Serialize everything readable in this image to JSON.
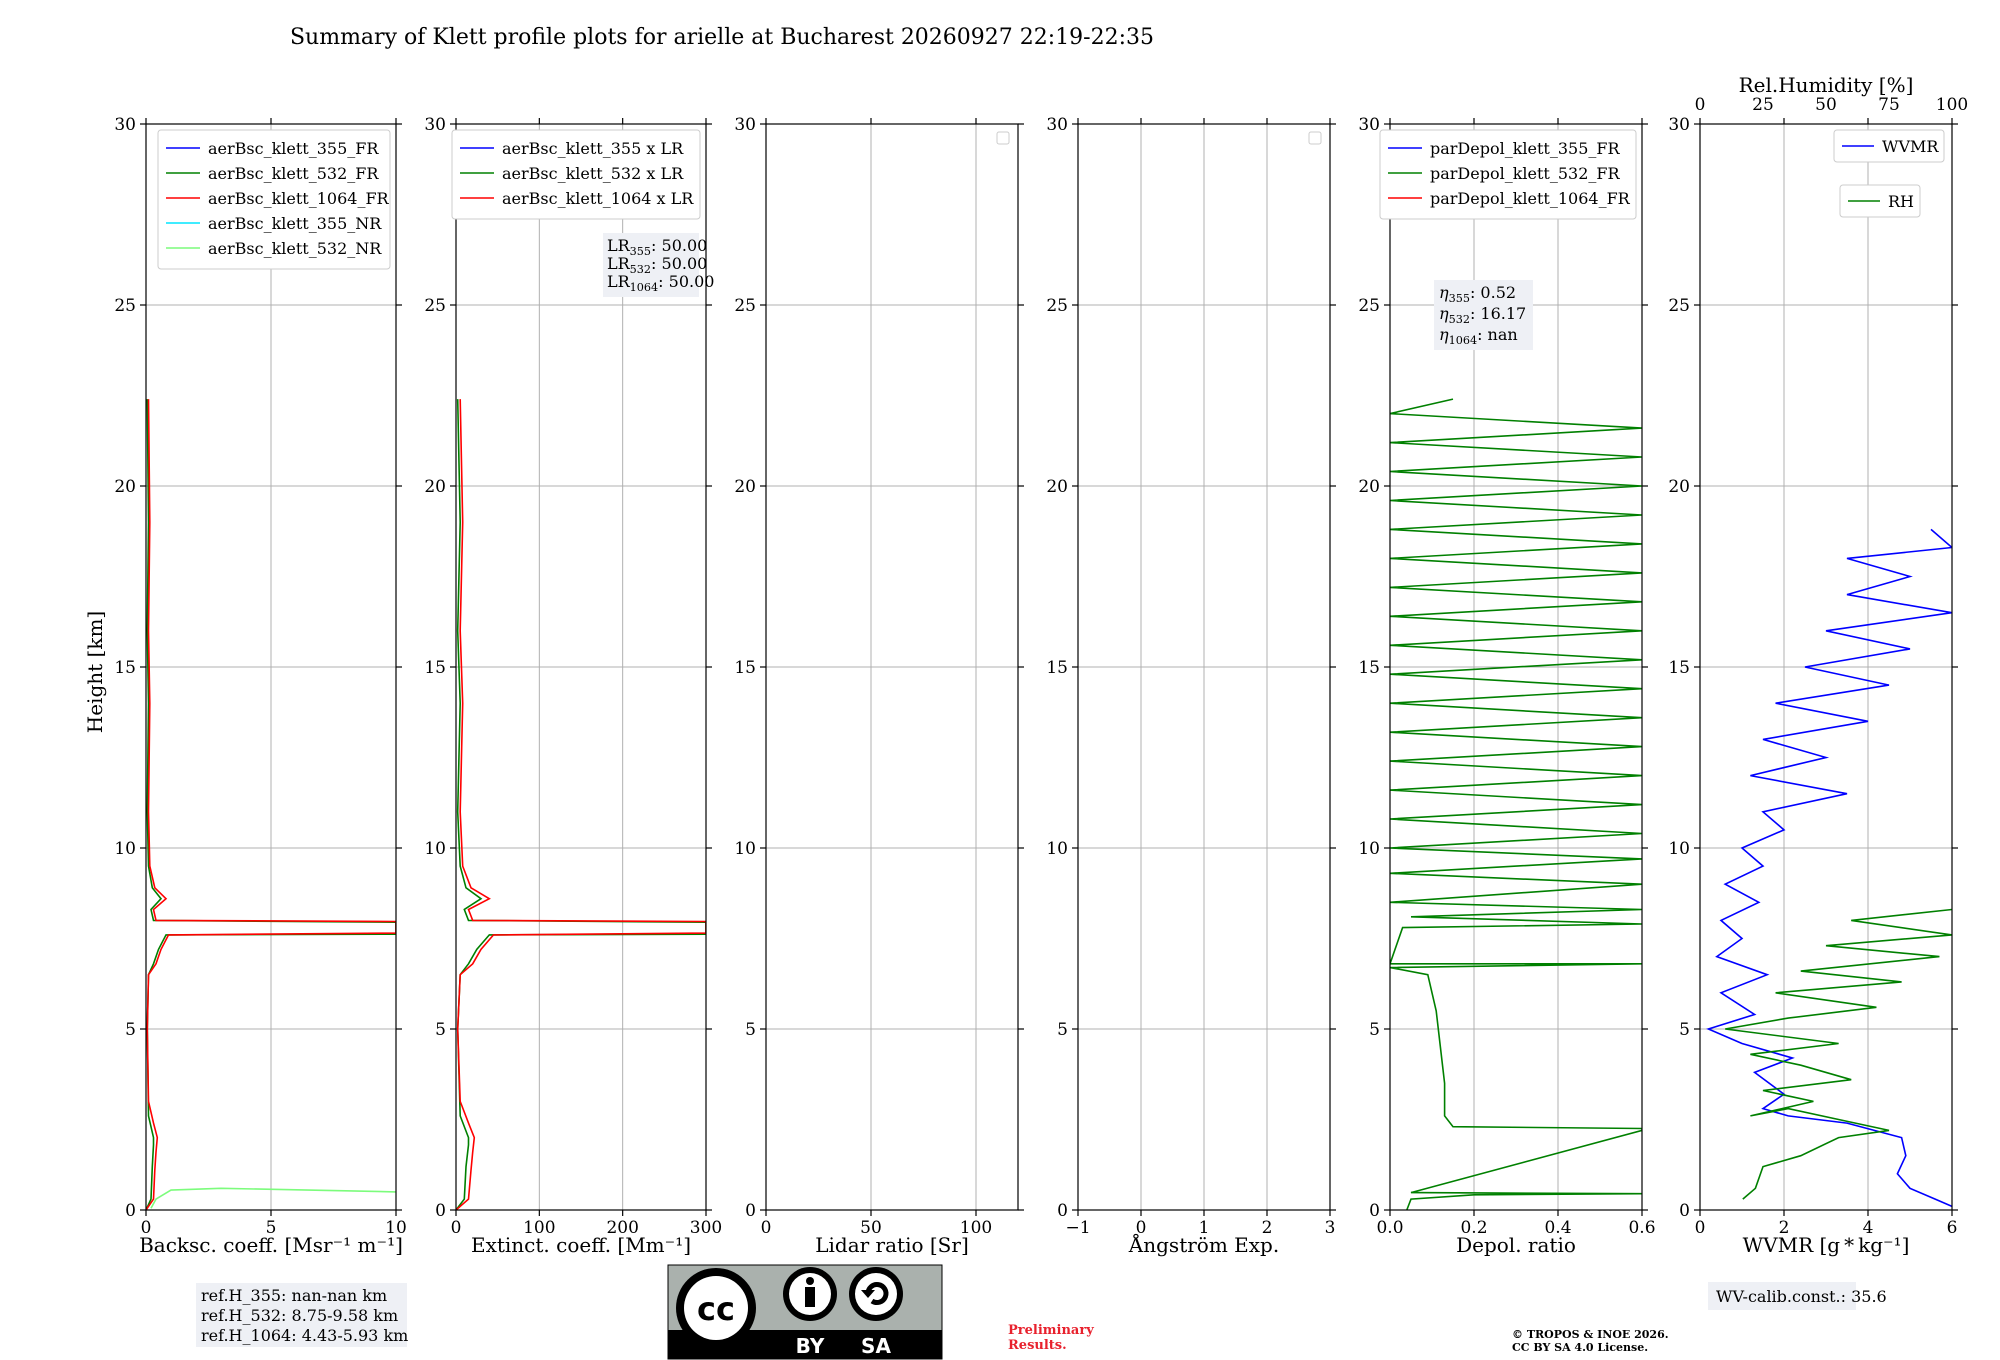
{
  "title": "Summary of Klett profile plots for arielle at Bucharest 20260927 22:19-22:35",
  "y_label": "Height [km]",
  "y_ticks": [
    "0",
    "5",
    "10",
    "15",
    "20",
    "25",
    "30"
  ],
  "chart_data": [
    {
      "type": "line",
      "xlabel": "Backsc. coeff. [Msr⁻¹ m⁻¹]",
      "xlim": [
        0,
        10
      ],
      "ylim": [
        0,
        30
      ],
      "x_ticks": [
        "0",
        "5",
        "10"
      ],
      "grid": true,
      "legend": "top-right",
      "series": [
        {
          "name": "aerBsc_klett_355_FR",
          "color": "#0000ff",
          "points": []
        },
        {
          "name": "aerBsc_klett_532_FR",
          "color": "#008000",
          "points": [
            [
              0,
              0
            ],
            [
              0.2,
              0.3
            ],
            [
              0.25,
              1.2
            ],
            [
              0.3,
              1.8
            ],
            [
              0.3,
              2.0
            ],
            [
              0.1,
              2.6
            ],
            [
              0.05,
              5
            ],
            [
              0.1,
              6.5
            ],
            [
              0.3,
              6.8
            ],
            [
              0.5,
              7.2
            ],
            [
              0.8,
              7.6
            ],
            [
              10,
              7.62
            ],
            [
              10,
              7.95
            ],
            [
              0.3,
              8.0
            ],
            [
              0.2,
              8.3
            ],
            [
              0.6,
              8.6
            ],
            [
              0.25,
              8.9
            ],
            [
              0.1,
              9.5
            ],
            [
              0.05,
              11
            ],
            [
              0.1,
              14
            ],
            [
              0.05,
              16
            ],
            [
              0.1,
              19
            ],
            [
              0.05,
              22.4
            ]
          ]
        },
        {
          "name": "aerBsc_klett_1064_FR",
          "color": "#ff0000",
          "points": [
            [
              0,
              0
            ],
            [
              0.3,
              0.3
            ],
            [
              0.35,
              1.1
            ],
            [
              0.4,
              1.6
            ],
            [
              0.45,
              2.0
            ],
            [
              0.3,
              2.4
            ],
            [
              0.1,
              3
            ],
            [
              0.05,
              5
            ],
            [
              0.1,
              6.5
            ],
            [
              0.4,
              6.8
            ],
            [
              0.6,
              7.2
            ],
            [
              0.9,
              7.6
            ],
            [
              10,
              7.65
            ],
            [
              10,
              7.97
            ],
            [
              0.4,
              8.0
            ],
            [
              0.3,
              8.3
            ],
            [
              0.8,
              8.6
            ],
            [
              0.35,
              8.9
            ],
            [
              0.15,
              9.5
            ],
            [
              0.1,
              11
            ],
            [
              0.15,
              14
            ],
            [
              0.1,
              16
            ],
            [
              0.15,
              19
            ],
            [
              0.1,
              22.4
            ]
          ]
        },
        {
          "name": "aerBsc_klett_355_NR",
          "color": "#00e5ff",
          "points": []
        },
        {
          "name": "aerBsc_klett_532_NR",
          "color": "#7cfc7c",
          "points": [
            [
              0.2,
              0.05
            ],
            [
              0.4,
              0.3
            ],
            [
              1,
              0.55
            ],
            [
              3,
              0.6
            ],
            [
              10,
              0.5
            ]
          ]
        }
      ],
      "info": []
    },
    {
      "type": "line",
      "xlabel": "Extinct. coeff. [Mm⁻¹]",
      "xlim": [
        0,
        300
      ],
      "ylim": [
        0,
        30
      ],
      "x_ticks": [
        "0",
        "100",
        "200",
        "300"
      ],
      "grid": true,
      "legend": "top-right",
      "series": [
        {
          "name": "aerBsc_klett_355 x LR",
          "color": "#0000ff",
          "points": []
        },
        {
          "name": "aerBsc_klett_532 x LR",
          "color": "#008000",
          "points": [
            [
              0,
              0
            ],
            [
              10,
              0.3
            ],
            [
              12,
              1.2
            ],
            [
              15,
              1.8
            ],
            [
              15,
              2.0
            ],
            [
              5,
              2.6
            ],
            [
              2,
              5
            ],
            [
              5,
              6.5
            ],
            [
              15,
              6.8
            ],
            [
              25,
              7.2
            ],
            [
              40,
              7.6
            ],
            [
              300,
              7.62
            ],
            [
              300,
              7.95
            ],
            [
              15,
              8.0
            ],
            [
              10,
              8.3
            ],
            [
              30,
              8.6
            ],
            [
              12,
              8.9
            ],
            [
              5,
              9.5
            ],
            [
              2,
              11
            ],
            [
              5,
              14
            ],
            [
              2,
              16
            ],
            [
              5,
              19
            ],
            [
              2,
              22.4
            ]
          ]
        },
        {
          "name": "aerBsc_klett_1064 x LR",
          "color": "#ff0000",
          "points": [
            [
              0,
              0
            ],
            [
              15,
              0.3
            ],
            [
              18,
              1.1
            ],
            [
              20,
              1.6
            ],
            [
              22,
              2.0
            ],
            [
              15,
              2.4
            ],
            [
              5,
              3
            ],
            [
              2,
              5
            ],
            [
              5,
              6.5
            ],
            [
              20,
              6.8
            ],
            [
              30,
              7.2
            ],
            [
              45,
              7.6
            ],
            [
              300,
              7.65
            ],
            [
              300,
              7.97
            ],
            [
              20,
              8.0
            ],
            [
              15,
              8.3
            ],
            [
              40,
              8.6
            ],
            [
              18,
              8.9
            ],
            [
              8,
              9.5
            ],
            [
              5,
              11
            ],
            [
              8,
              14
            ],
            [
              5,
              16
            ],
            [
              8,
              19
            ],
            [
              5,
              22.4
            ]
          ]
        }
      ],
      "info": [
        "LR355: 50.00",
        "LR532: 50.00",
        "LR1064: 50.00"
      ]
    },
    {
      "type": "line",
      "xlabel": "Lidar ratio [Sr]",
      "xlim": [
        0,
        120
      ],
      "ylim": [
        0,
        30
      ],
      "x_ticks": [
        "0",
        "50",
        "100"
      ],
      "grid": true,
      "legend": "top-right",
      "series": [],
      "info": []
    },
    {
      "type": "line",
      "xlabel": "Ångström Exp.",
      "xlim": [
        -1,
        3
      ],
      "ylim": [
        0,
        30
      ],
      "x_ticks": [
        "−1",
        "0",
        "1",
        "2",
        "3"
      ],
      "grid": true,
      "legend": "top-right",
      "series": [],
      "info": []
    },
    {
      "type": "line",
      "xlabel": "Depol. ratio",
      "xlim": [
        0,
        0.6
      ],
      "ylim": [
        0,
        30
      ],
      "x_ticks": [
        "0.0",
        "0.2",
        "0.4",
        "0.6"
      ],
      "grid": true,
      "legend": "top-right",
      "series": [
        {
          "name": "parDepol_klett_355_FR",
          "color": "#0000ff",
          "points": []
        },
        {
          "name": "parDepol_klett_532_FR",
          "color": "#008000",
          "points": [
            [
              0.04,
              0
            ],
            [
              0.05,
              0.3
            ],
            [
              0.2,
              0.42
            ],
            [
              0.6,
              0.45
            ],
            [
              0.05,
              0.48
            ],
            [
              0.6,
              2.2
            ],
            [
              0.6,
              2.25
            ],
            [
              0.15,
              2.3
            ],
            [
              0.13,
              2.6
            ],
            [
              0.13,
              3.5
            ],
            [
              0.12,
              4.5
            ],
            [
              0.11,
              5.5
            ],
            [
              0.09,
              6.5
            ],
            [
              0.0,
              6.7
            ],
            [
              0.6,
              6.8
            ],
            [
              0.0,
              6.8
            ],
            [
              0.03,
              7.8
            ],
            [
              0.6,
              7.9
            ],
            [
              0.05,
              8.1
            ],
            [
              0.6,
              8.3
            ],
            [
              0.0,
              8.5
            ],
            [
              0.6,
              9.0
            ],
            [
              0.0,
              9.3
            ],
            [
              0.6,
              9.7
            ],
            [
              0.0,
              10.0
            ],
            [
              0.6,
              10.4
            ],
            [
              0.0,
              10.8
            ],
            [
              0.6,
              11.2
            ],
            [
              0.0,
              11.6
            ],
            [
              0.6,
              12.0
            ],
            [
              0.0,
              12.4
            ],
            [
              0.6,
              12.8
            ],
            [
              0.0,
              13.2
            ],
            [
              0.6,
              13.6
            ],
            [
              0.0,
              14.0
            ],
            [
              0.6,
              14.4
            ],
            [
              0.0,
              14.8
            ],
            [
              0.6,
              15.2
            ],
            [
              0.0,
              15.6
            ],
            [
              0.6,
              16.0
            ],
            [
              0.0,
              16.4
            ],
            [
              0.6,
              16.8
            ],
            [
              0.0,
              17.2
            ],
            [
              0.6,
              17.6
            ],
            [
              0.0,
              18.0
            ],
            [
              0.6,
              18.4
            ],
            [
              0.0,
              18.8
            ],
            [
              0.6,
              19.2
            ],
            [
              0.0,
              19.6
            ],
            [
              0.6,
              20.0
            ],
            [
              0.0,
              20.4
            ],
            [
              0.6,
              20.8
            ],
            [
              0.0,
              21.2
            ],
            [
              0.6,
              21.6
            ],
            [
              0.0,
              22.0
            ],
            [
              0.15,
              22.4
            ]
          ]
        },
        {
          "name": "parDepol_klett_1064_FR",
          "color": "#ff0000",
          "points": []
        }
      ],
      "info": [
        "η355: 0.52",
        "η532: 16.17",
        "η1064: nan"
      ]
    },
    {
      "type": "line",
      "xlabel": "WVMR [g * kg⁻¹]",
      "top_xlabel": "Rel.Humidity [%]",
      "xlim": [
        0,
        6
      ],
      "top_xlim": [
        0,
        100
      ],
      "ylim": [
        0,
        30
      ],
      "x_ticks": [
        "0",
        "2",
        "4",
        "6"
      ],
      "top_x_ticks": [
        "0",
        "25",
        "50",
        "75",
        "100"
      ],
      "grid": true,
      "legend": "top-right",
      "series": [
        {
          "name": "WVMR",
          "color": "#0000ff",
          "points": [
            [
              6,
              0.1
            ],
            [
              5.6,
              0.3
            ],
            [
              5.0,
              0.6
            ],
            [
              4.7,
              1.0
            ],
            [
              4.9,
              1.5
            ],
            [
              4.8,
              2.0
            ],
            [
              3.5,
              2.4
            ],
            [
              2.1,
              2.6
            ],
            [
              1.5,
              2.8
            ],
            [
              2.0,
              3.2
            ],
            [
              1.3,
              3.8
            ],
            [
              2.2,
              4.2
            ],
            [
              1.0,
              4.6
            ],
            [
              0.2,
              5.0
            ],
            [
              1.3,
              5.4
            ],
            [
              0.5,
              6.0
            ],
            [
              1.6,
              6.5
            ],
            [
              0.4,
              7.0
            ],
            [
              1.0,
              7.5
            ],
            [
              0.5,
              8.0
            ],
            [
              1.4,
              8.5
            ],
            [
              0.6,
              9.0
            ],
            [
              1.5,
              9.5
            ],
            [
              1.0,
              10.0
            ],
            [
              2.0,
              10.5
            ],
            [
              1.5,
              11.0
            ],
            [
              3.5,
              11.5
            ],
            [
              1.2,
              12.0
            ],
            [
              3.0,
              12.5
            ],
            [
              1.5,
              13.0
            ],
            [
              4.0,
              13.5
            ],
            [
              1.8,
              14.0
            ],
            [
              4.5,
              14.5
            ],
            [
              2.5,
              15.0
            ],
            [
              5.0,
              15.5
            ],
            [
              3.0,
              16.0
            ],
            [
              6.0,
              16.5
            ],
            [
              3.5,
              17.0
            ],
            [
              5.0,
              17.5
            ],
            [
              3.5,
              18.0
            ],
            [
              6.0,
              18.3
            ],
            [
              5.5,
              18.8
            ]
          ]
        },
        {
          "name": "RH",
          "color": "#008000",
          "top_axis": true,
          "points": [
            [
              17,
              0.3
            ],
            [
              22,
              0.6
            ],
            [
              25,
              1.2
            ],
            [
              40,
              1.5
            ],
            [
              55,
              2.0
            ],
            [
              75,
              2.2
            ],
            [
              55,
              2.5
            ],
            [
              35,
              2.8
            ],
            [
              20,
              2.6
            ],
            [
              45,
              3.0
            ],
            [
              25,
              3.3
            ],
            [
              60,
              3.6
            ],
            [
              40,
              4.0
            ],
            [
              20,
              4.3
            ],
            [
              55,
              4.6
            ],
            [
              10,
              5.0
            ],
            [
              35,
              5.3
            ],
            [
              70,
              5.6
            ],
            [
              30,
              6.0
            ],
            [
              80,
              6.3
            ],
            [
              40,
              6.6
            ],
            [
              95,
              7.0
            ],
            [
              50,
              7.3
            ],
            [
              100,
              7.6
            ],
            [
              60,
              8.0
            ],
            [
              100,
              8.3
            ]
          ]
        }
      ],
      "info": [
        "WV-calib.const.: 35.6"
      ]
    }
  ],
  "ref_heights": [
    "ref.H_355: nan-nan km",
    "ref.H_532: 8.75-9.58 km",
    "ref.H_1064: 4.43-5.93 km"
  ],
  "footer": {
    "license_badge": [
      "BY",
      "SA"
    ],
    "preliminary": [
      "Preliminary",
      "Results."
    ],
    "copyright": [
      "© TROPOS & INOE 2026.",
      "CC BY SA 4.0 License."
    ]
  }
}
